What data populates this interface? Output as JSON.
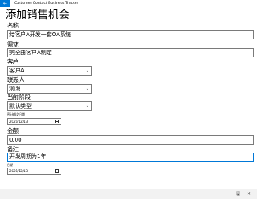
{
  "app": {
    "title": "Customer Contact Business Tracker",
    "back_glyph": "←"
  },
  "page": {
    "title": "添加销售机会"
  },
  "form": {
    "name": {
      "label": "名称",
      "value": "给客户A开发一套OA系统"
    },
    "requirement": {
      "label": "需求",
      "value": "完全由客户A制定"
    },
    "customer": {
      "label": "客户",
      "value": "客户A"
    },
    "contact": {
      "label": "联系人",
      "value": "涧发"
    },
    "stage": {
      "label": "当前阶段",
      "value": "默认类型"
    },
    "expected_date": {
      "label": "预计成交日期",
      "value": "2021/12/13"
    },
    "amount": {
      "label": "金额",
      "value": "0.00"
    },
    "note": {
      "label": "备注",
      "value": "开发周期为1年"
    },
    "date": {
      "label": "日期",
      "value": "2021/12/13"
    }
  },
  "icons": {
    "chevron": "⌄",
    "save": "🖫",
    "close": "✕"
  },
  "colors": {
    "accent": "#0078d7",
    "bottom_bar": "#f2f2f2"
  }
}
